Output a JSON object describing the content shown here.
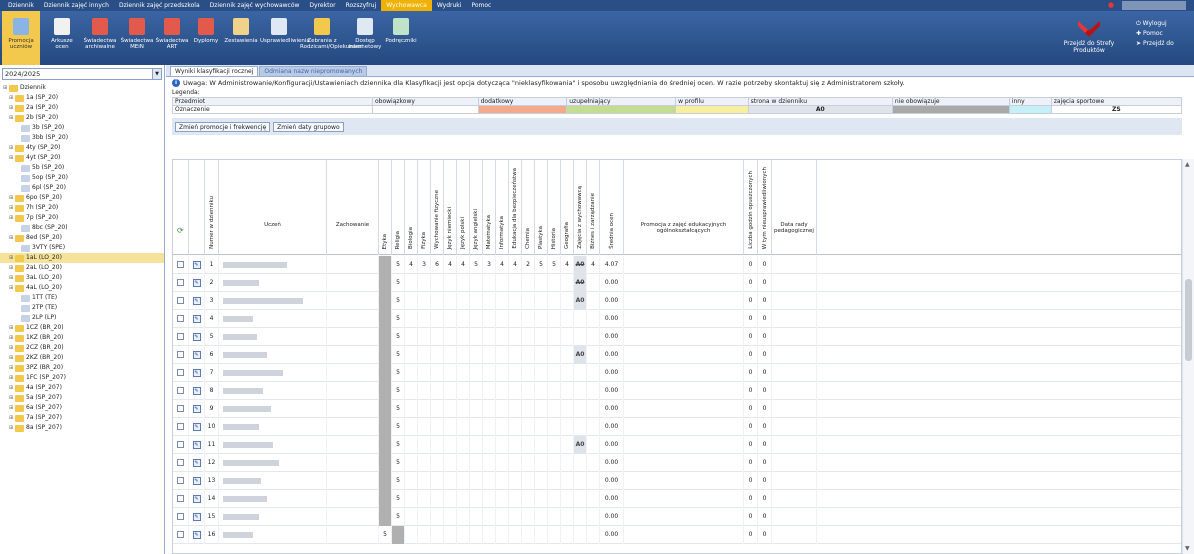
{
  "menubar": {
    "items": [
      "Dziennik",
      "Dziennik zajęć innych",
      "Dziennik zajęć przedszkola",
      "Dziennik zajęć wychowawców",
      "Dyrektor",
      "Rozszyfruj",
      "Wychowawca",
      "Wydruki",
      "Pomoc"
    ],
    "active_index": 6
  },
  "ribbon": {
    "buttons": [
      {
        "label": "Promocja uczniów",
        "icon": "promotion-icon",
        "active": true
      },
      {
        "label": "Arkusze ocen",
        "icon": "sheet-icon",
        "active": false
      },
      {
        "label": "Świadectwa archiwalne",
        "icon": "certificate-icon",
        "active": false
      },
      {
        "label": "Świadectwa MEiN",
        "icon": "certificate-icon",
        "active": false
      },
      {
        "label": "Świadectwa ART",
        "icon": "certificate-icon",
        "active": false
      },
      {
        "label": "Dyplomy",
        "icon": "diploma-icon",
        "active": false
      },
      {
        "label": "Zestawienia",
        "icon": "report-icon",
        "active": false
      },
      {
        "label": "Usprawiedliwienia",
        "icon": "document-icon",
        "active": false
      },
      {
        "label": "Zebrania z Rodzicami/Opiekunami",
        "icon": "meeting-icon",
        "active": false
      },
      {
        "label": "Dostęp internetowy",
        "icon": "internet-icon",
        "active": false
      },
      {
        "label": "Podręczniki",
        "icon": "books-icon",
        "active": false
      }
    ],
    "strefa_label": "Przejdź do Strefy Produktów",
    "right_links": [
      "Wyloguj",
      "Pomoc",
      "Przejdź do"
    ]
  },
  "sidebar": {
    "year": "2024/2025",
    "tree": [
      {
        "label": "Dziennik",
        "level": 0,
        "type": "root"
      },
      {
        "label": "1a (SP_20)",
        "level": 1,
        "type": "folder"
      },
      {
        "label": "2a (SP_20)",
        "level": 1,
        "type": "folder"
      },
      {
        "label": "2b (SP_20)",
        "level": 1,
        "type": "folder"
      },
      {
        "label": "3b (SP_20)",
        "level": 2,
        "type": "leaf"
      },
      {
        "label": "3bb (SP_20)",
        "level": 2,
        "type": "leaf"
      },
      {
        "label": "4ty (SP_20)",
        "level": 1,
        "type": "folder"
      },
      {
        "label": "4yt (SP_20)",
        "level": 1,
        "type": "folder"
      },
      {
        "label": "5b (SP_20)",
        "level": 2,
        "type": "leaf"
      },
      {
        "label": "5op (SP_20)",
        "level": 2,
        "type": "leaf"
      },
      {
        "label": "6pl (SP_20)",
        "level": 2,
        "type": "leaf"
      },
      {
        "label": "6po (SP_20)",
        "level": 1,
        "type": "folder"
      },
      {
        "label": "7h (SP_20)",
        "level": 1,
        "type": "folder"
      },
      {
        "label": "7p (SP_20)",
        "level": 1,
        "type": "folder"
      },
      {
        "label": "8bc (SP_20)",
        "level": 2,
        "type": "leaf"
      },
      {
        "label": "8ed (SP_20)",
        "level": 1,
        "type": "folder"
      },
      {
        "label": "3VTY (SPE)",
        "level": 2,
        "type": "leaf"
      },
      {
        "label": "1aL (LO_20)",
        "level": 1,
        "type": "folder",
        "selected": true
      },
      {
        "label": "2aL (LO_20)",
        "level": 1,
        "type": "folder"
      },
      {
        "label": "3aL (LO_20)",
        "level": 1,
        "type": "folder"
      },
      {
        "label": "4aL (LO_20)",
        "level": 1,
        "type": "folder"
      },
      {
        "label": "1TT (TE)",
        "level": 2,
        "type": "leaf"
      },
      {
        "label": "2TP (TE)",
        "level": 2,
        "type": "leaf"
      },
      {
        "label": "2LP (LP)",
        "level": 2,
        "type": "leaf"
      },
      {
        "label": "1CZ (BR_20)",
        "level": 1,
        "type": "folder"
      },
      {
        "label": "1KZ (BR_20)",
        "level": 1,
        "type": "folder"
      },
      {
        "label": "2CZ (BR_20)",
        "level": 1,
        "type": "folder"
      },
      {
        "label": "2KZ (BR_20)",
        "level": 1,
        "type": "folder"
      },
      {
        "label": "3PZ (BR_20)",
        "level": 1,
        "type": "folder"
      },
      {
        "label": "1FC (SP_207)",
        "level": 1,
        "type": "folder"
      },
      {
        "label": "4a (SP_207)",
        "level": 1,
        "type": "folder"
      },
      {
        "label": "5a (SP_207)",
        "level": 1,
        "type": "folder"
      },
      {
        "label": "6a (SP_207)",
        "level": 1,
        "type": "folder"
      },
      {
        "label": "7a (SP_207)",
        "level": 1,
        "type": "folder"
      },
      {
        "label": "8a (SP_207)",
        "level": 1,
        "type": "folder"
      }
    ]
  },
  "tabs": [
    {
      "label": "Wyniki klasyfikacji rocznej",
      "active": true
    },
    {
      "label": "Odmiana nazw niepromowanych",
      "active": false
    }
  ],
  "notice": "Uwaga: W Administrowanie/Konfiguracji/Ustawieniach dziennika dla Klasyfikacji jest opcja dotycząca \"nieklasyfikowania\" i sposobu uwzględniania do średniej ocen. W razie potrzeby skontaktuj się z Administratorem szkoły.",
  "legend": {
    "title": "Legenda:",
    "header_label": "Przedmiot",
    "row_label": "Oznaczenie",
    "items": [
      {
        "label": "obowiązkowy",
        "mark": "",
        "color": "#ffffff"
      },
      {
        "label": "dodatkowy",
        "mark": "",
        "color": "#f4a98a"
      },
      {
        "label": "uzupełniający",
        "mark": "",
        "color": "#c3dd8f"
      },
      {
        "label": "w profilu",
        "mark": "",
        "color": "#f7ef9e"
      },
      {
        "label": "strona w dzienniku",
        "mark": "A0",
        "color": "#dfe3ea"
      },
      {
        "label": "nie obowiązuje",
        "mark": "",
        "color": "#a9a9a9"
      },
      {
        "label": "inny",
        "mark": "",
        "color": "#c5f0f7"
      },
      {
        "label": "zajęcia sportowe",
        "mark": "ZS",
        "color": "#ffffff"
      }
    ]
  },
  "buttons": {
    "promo": "Zmień promocje i frekwencję",
    "dates": "Zmień daty grupowo"
  },
  "grid": {
    "headers": {
      "nr": "Numer w dzienniku",
      "student": "Uczeń",
      "behavior": "Zachowanie",
      "subjects": [
        "Etyka",
        "Religia",
        "Biologia",
        "Fizyka",
        "Wychowanie fizyczne",
        "Język niemiecki",
        "Język polski",
        "Język angielski",
        "Matematyka",
        "Informatyka",
        "Edukacja dla bezpieczeństwa",
        "Chemia",
        "Plastyka",
        "Historia",
        "Geografia",
        "Zajęcia z wychowawcą",
        "Biznes i zarządzanie"
      ],
      "avg": "Średnia ocen",
      "promotion": "Promocja z zajęć edukacyjnych ogólnokształcących",
      "absences": "Liczba godzin opuszczonych",
      "unexcused": "W tym nieusprawiedliwionych",
      "date": "Data rady pedagogicznej"
    },
    "rows": [
      {
        "nr": "1",
        "grades": [
          "",
          "5",
          "4",
          "3",
          "6",
          "4",
          "4",
          "5",
          "3",
          "4",
          "4",
          "2",
          "5",
          "5",
          "4",
          "A0",
          "4"
        ],
        "avg": "4.07",
        "abs": "0",
        "unex": "0",
        "strike": true
      },
      {
        "nr": "2",
        "grades": [
          "",
          "5",
          "",
          "",
          "",
          "",
          "",
          "",
          "",
          "",
          "",
          "",
          "",
          "",
          "",
          "A0",
          ""
        ],
        "avg": "0.00",
        "abs": "0",
        "unex": "0",
        "strike": true
      },
      {
        "nr": "3",
        "grades": [
          "",
          "5",
          "",
          "",
          "",
          "",
          "",
          "",
          "",
          "",
          "",
          "",
          "",
          "",
          "",
          "A0",
          ""
        ],
        "avg": "0.00",
        "abs": "0",
        "unex": "0",
        "strike": false
      },
      {
        "nr": "4",
        "grades": [
          "",
          "5",
          "",
          "",
          "",
          "",
          "",
          "",
          "",
          "",
          "",
          "",
          "",
          "",
          "",
          "",
          ""
        ],
        "avg": "0.00",
        "abs": "0",
        "unex": "0",
        "strike": false
      },
      {
        "nr": "5",
        "grades": [
          "",
          "5",
          "",
          "",
          "",
          "",
          "",
          "",
          "",
          "",
          "",
          "",
          "",
          "",
          "",
          "",
          ""
        ],
        "avg": "0.00",
        "abs": "0",
        "unex": "0",
        "strike": false
      },
      {
        "nr": "6",
        "grades": [
          "",
          "5",
          "",
          "",
          "",
          "",
          "",
          "",
          "",
          "",
          "",
          "",
          "",
          "",
          "",
          "A0",
          ""
        ],
        "avg": "0.00",
        "abs": "0",
        "unex": "0",
        "strike": false
      },
      {
        "nr": "7",
        "grades": [
          "",
          "5",
          "",
          "",
          "",
          "",
          "",
          "",
          "",
          "",
          "",
          "",
          "",
          "",
          "",
          "",
          ""
        ],
        "avg": "0.00",
        "abs": "0",
        "unex": "0",
        "strike": false
      },
      {
        "nr": "8",
        "grades": [
          "",
          "5",
          "",
          "",
          "",
          "",
          "",
          "",
          "",
          "",
          "",
          "",
          "",
          "",
          "",
          "",
          ""
        ],
        "avg": "0.00",
        "abs": "0",
        "unex": "0",
        "strike": false
      },
      {
        "nr": "9",
        "grades": [
          "",
          "5",
          "",
          "",
          "",
          "",
          "",
          "",
          "",
          "",
          "",
          "",
          "",
          "",
          "",
          "",
          ""
        ],
        "avg": "0.00",
        "abs": "0",
        "unex": "0",
        "strike": false
      },
      {
        "nr": "10",
        "grades": [
          "",
          "5",
          "",
          "",
          "",
          "",
          "",
          "",
          "",
          "",
          "",
          "",
          "",
          "",
          "",
          "",
          ""
        ],
        "avg": "0.00",
        "abs": "0",
        "unex": "0",
        "strike": false
      },
      {
        "nr": "11",
        "grades": [
          "",
          "5",
          "",
          "",
          "",
          "",
          "",
          "",
          "",
          "",
          "",
          "",
          "",
          "",
          "",
          "A0",
          ""
        ],
        "avg": "0.00",
        "abs": "0",
        "unex": "0",
        "strike": false
      },
      {
        "nr": "12",
        "grades": [
          "",
          "5",
          "",
          "",
          "",
          "",
          "",
          "",
          "",
          "",
          "",
          "",
          "",
          "",
          "",
          "",
          ""
        ],
        "avg": "0.00",
        "abs": "0",
        "unex": "0",
        "strike": false
      },
      {
        "nr": "13",
        "grades": [
          "",
          "5",
          "",
          "",
          "",
          "",
          "",
          "",
          "",
          "",
          "",
          "",
          "",
          "",
          "",
          "",
          ""
        ],
        "avg": "0.00",
        "abs": "0",
        "unex": "0",
        "strike": false
      },
      {
        "nr": "14",
        "grades": [
          "",
          "5",
          "",
          "",
          "",
          "",
          "",
          "",
          "",
          "",
          "",
          "",
          "",
          "",
          "",
          "",
          ""
        ],
        "avg": "0.00",
        "abs": "0",
        "unex": "0",
        "strike": false
      },
      {
        "nr": "15",
        "grades": [
          "",
          "5",
          "",
          "",
          "",
          "",
          "",
          "",
          "",
          "",
          "",
          "",
          "",
          "",
          "",
          "",
          ""
        ],
        "avg": "0.00",
        "abs": "0",
        "unex": "0",
        "strike": false
      },
      {
        "nr": "16",
        "grades": [
          "5",
          "",
          "",
          "",
          "",
          "",
          "",
          "",
          "",
          "",
          "",
          "",
          "",
          "",
          "",
          "",
          ""
        ],
        "avg": "0.00",
        "abs": "0",
        "unex": "0",
        "strike": false
      }
    ]
  }
}
